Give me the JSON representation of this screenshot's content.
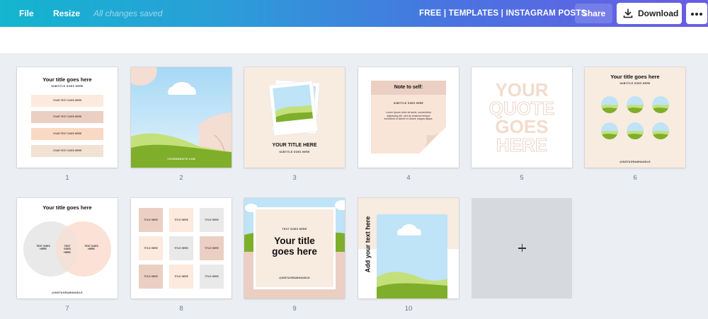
{
  "topbar": {
    "file": "File",
    "resize": "Resize",
    "saved": "All changes saved",
    "title": "FREE | TEMPLATES | INSTAGRAM POSTS",
    "share": "Share",
    "download": "Download"
  },
  "icons": {
    "download": "download-icon",
    "more": "more-options-icon",
    "add": "plus-icon"
  },
  "colors": {
    "accent_start": "#13b5cf",
    "accent_end": "#6a5ce6",
    "peach": "#f8ebe0",
    "rose": "#ebcfc3",
    "sky": "#bfe3f7",
    "grass": "#7fae2a"
  },
  "pages": [
    {
      "number": "1",
      "title": "Your title goes here",
      "subtitle": "SUBTITLE GOES HERE",
      "rows": [
        "YOUR TEXT GOES HERE",
        "YOUR TEXT GOES HERE",
        "YOUR TEXT GOES HERE",
        "YOUR TEXT GOES HERE"
      ]
    },
    {
      "number": "2",
      "website": "YOURWEBSITE.COM"
    },
    {
      "number": "3",
      "title": "YOUR TITLE HERE",
      "subtitle": "SUBTITLE GOES HERE"
    },
    {
      "number": "4",
      "title": "Note to self:",
      "subtitle": "SUBTITLE GOES HERE",
      "body": "Lorem ipsum dolor sit amet, consectetur adipiscing elit, sed do eiusmod tempor incididunt ut labore et dolore magna aliqua."
    },
    {
      "number": "5",
      "quote": [
        "YOUR",
        "QUOTE",
        "GOES",
        "HERE"
      ]
    },
    {
      "number": "6",
      "title": "Your title goes here",
      "subtitle": "SUBTITLE GOES HERE",
      "handle": "@INSTAGRAMHANDLE"
    },
    {
      "number": "7",
      "title": "Your title goes here",
      "left": "TEXT GOES HERE",
      "middle": "TEXT GOES HERE",
      "right": "TEXT GOES HERE",
      "handle": "@INSTAGRAMHANDLE"
    },
    {
      "number": "8",
      "cell": "TITLE HERE"
    },
    {
      "number": "9",
      "kicker": "TEXT GOES HERE",
      "title_line1": "Your title",
      "title_line2": "goes here",
      "handle": "@INSTAGRAMHANDLE"
    },
    {
      "number": "10",
      "vertical": "Add your text here"
    }
  ]
}
